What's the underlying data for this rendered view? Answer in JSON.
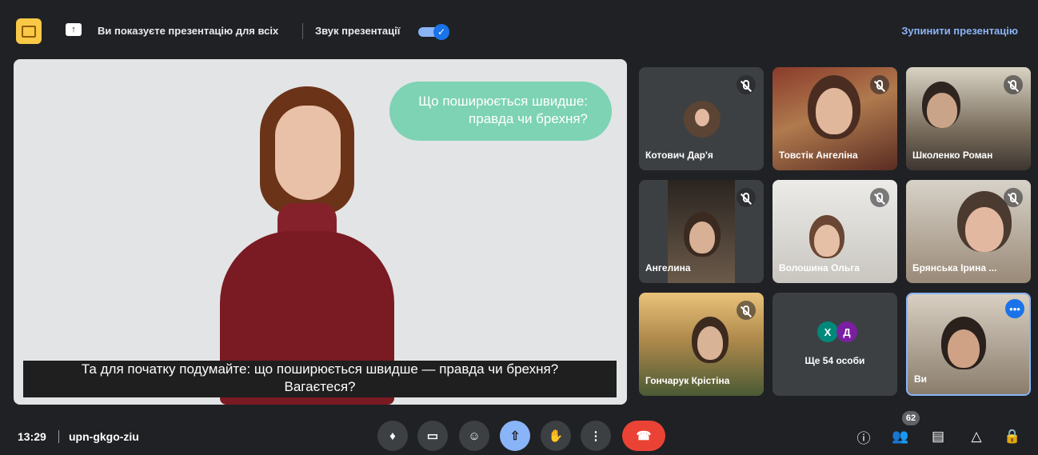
{
  "top_bar": {
    "presenting_text": "Ви показуєте презентацію для всіх",
    "audio_label": "Звук презентації",
    "audio_enabled": true,
    "stop_label": "Зупинити презентацію"
  },
  "presentation": {
    "bubble_line1": "Що поширюється швидше:",
    "bubble_line2": "правда чи брехня?",
    "caption_line1": "Та для початку подумайте: що поширюється швидше — правда чи брехня?",
    "caption_line2": "Вагаєтеся?"
  },
  "participants": [
    {
      "name": "Котович Дар'я",
      "muted": true,
      "camera_on": false
    },
    {
      "name": "Товстік Ангеліна",
      "muted": true,
      "camera_on": true
    },
    {
      "name": "Школенко Роман",
      "muted": true,
      "camera_on": true
    },
    {
      "name": "Ангелина",
      "muted": true,
      "camera_on": true
    },
    {
      "name": "Волошина Ольга",
      "muted": true,
      "camera_on": true
    },
    {
      "name": "Брянська Ірина ...",
      "muted": true,
      "camera_on": true
    },
    {
      "name": "Гончарук Крістіна",
      "muted": true,
      "camera_on": true
    }
  ],
  "more_tile": {
    "initials": [
      "Х",
      "Д"
    ],
    "initial_colors": [
      "#00897b",
      "#7b1fa2"
    ],
    "label": "Ще 54 особи"
  },
  "self_tile": {
    "name": "Ви",
    "more_icon": "more-options-icon"
  },
  "bottom_bar": {
    "time": "13:29",
    "meeting_code": "upn-gkgo-ziu",
    "participant_count": "62",
    "controls": [
      "microphone-icon",
      "camera-icon",
      "emoji-icon",
      "present-screen-icon",
      "raise-hand-icon",
      "more-options-icon",
      "end-call-icon"
    ],
    "right_icons": [
      "info-icon",
      "people-icon",
      "chat-icon",
      "activities-icon",
      "host-controls-icon"
    ]
  },
  "colors": {
    "accent": "#8ab4f8",
    "end_call": "#ea4335",
    "background": "#202124"
  }
}
